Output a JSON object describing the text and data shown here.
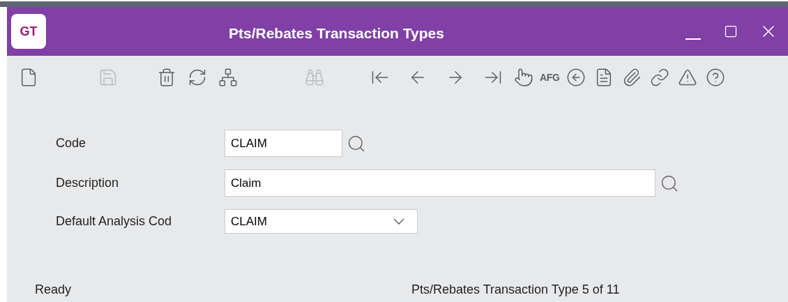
{
  "window": {
    "title": "Pts/Rebates Transaction Types",
    "logo": "GT"
  },
  "toolbar": [
    {
      "kind": "icon",
      "disabled": false
    },
    {
      "kind": "icon",
      "disabled": true
    },
    {
      "kind": "icon",
      "disabled": false
    },
    {
      "kind": "icon",
      "disabled": false
    },
    {
      "kind": "icon",
      "disabled": false
    },
    {
      "kind": "icon",
      "disabled": true
    },
    {
      "kind": "icon",
      "disabled": false
    },
    {
      "kind": "icon",
      "disabled": false
    },
    {
      "kind": "icon",
      "disabled": false
    },
    {
      "kind": "icon",
      "disabled": false
    },
    {
      "kind": "icon",
      "disabled": false
    },
    {
      "kind": "text",
      "label": "AFG",
      "disabled": false
    },
    {
      "kind": "icon",
      "disabled": false
    },
    {
      "kind": "icon",
      "disabled": false
    },
    {
      "kind": "icon",
      "disabled": false
    },
    {
      "kind": "icon",
      "disabled": false
    },
    {
      "kind": "icon",
      "disabled": false
    },
    {
      "kind": "icon",
      "disabled": false
    }
  ],
  "form": [
    {
      "kind": "lookup",
      "label": "Code",
      "value": "CLAIM"
    },
    {
      "kind": "lookup-wide",
      "label": "Description",
      "value": "Claim"
    },
    {
      "kind": "dropdown",
      "label": "Default Analysis Cod",
      "value": "CLAIM"
    }
  ],
  "status_bar": {
    "left": "Ready",
    "right": "Pts/Rebates Transaction Type 5 of 11"
  }
}
